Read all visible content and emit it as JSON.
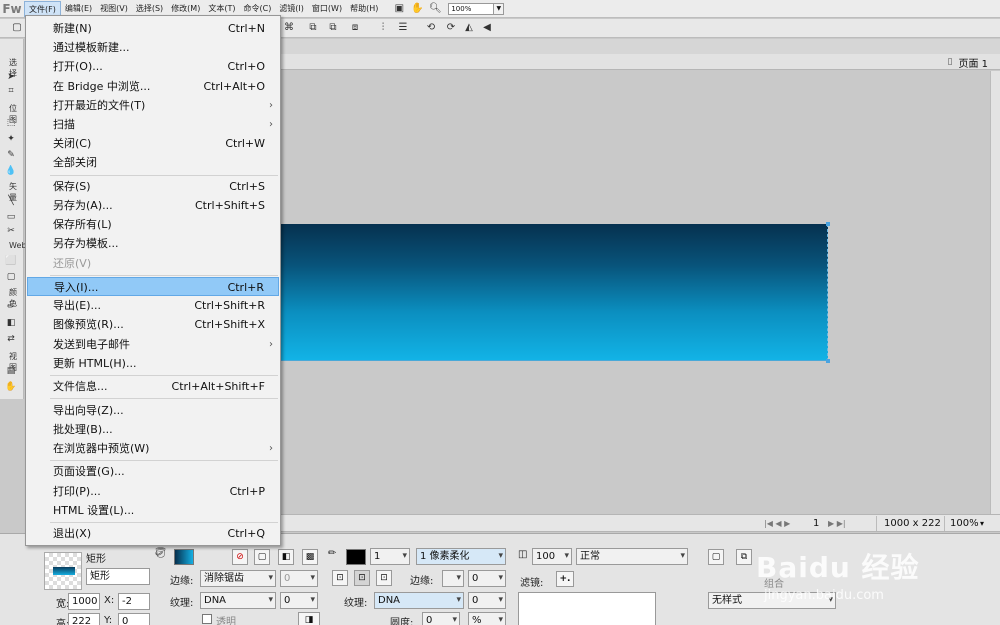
{
  "app": {
    "logo": "Fw",
    "menus": [
      "文件(F)",
      "编辑(E)",
      "视图(V)",
      "选择(S)",
      "修改(M)",
      "文本(T)",
      "命令(C)",
      "滤镜(I)",
      "窗口(W)",
      "帮助(H)"
    ],
    "zoom": "100%"
  },
  "file_menu": {
    "items": [
      {
        "label": "新建(N)",
        "shortcut": "Ctrl+N"
      },
      {
        "label": "通过模板新建...",
        "shortcut": ""
      },
      {
        "label": "打开(O)...",
        "shortcut": "Ctrl+O"
      },
      {
        "label": "在 Bridge 中浏览...",
        "shortcut": "Ctrl+Alt+O"
      },
      {
        "label": "打开最近的文件(T)",
        "shortcut": "",
        "submenu": true
      },
      {
        "label": "扫描",
        "shortcut": "",
        "submenu": true
      },
      {
        "label": "关闭(C)",
        "shortcut": "Ctrl+W"
      },
      {
        "label": "全部关闭",
        "shortcut": ""
      },
      {
        "label": "保存(S)",
        "shortcut": "Ctrl+S"
      },
      {
        "label": "另存为(A)...",
        "shortcut": "Ctrl+Shift+S"
      },
      {
        "label": "保存所有(L)",
        "shortcut": ""
      },
      {
        "label": "另存为模板...",
        "shortcut": ""
      },
      {
        "label": "还原(V)",
        "shortcut": "",
        "disabled": true
      },
      {
        "label": "导入(I)...",
        "shortcut": "Ctrl+R",
        "highlighted": true
      },
      {
        "label": "导出(E)...",
        "shortcut": "Ctrl+Shift+R"
      },
      {
        "label": "图像预览(R)...",
        "shortcut": "Ctrl+Shift+X"
      },
      {
        "label": "发送到电子邮件",
        "shortcut": "",
        "submenu": true
      },
      {
        "label": "更新 HTML(H)...",
        "shortcut": ""
      },
      {
        "label": "文件信息...",
        "shortcut": "Ctrl+Alt+Shift+F"
      },
      {
        "label": "导出向导(Z)...",
        "shortcut": ""
      },
      {
        "label": "批处理(B)...",
        "shortcut": ""
      },
      {
        "label": "在浏览器中预览(W)",
        "shortcut": "",
        "submenu": true
      },
      {
        "label": "页面设置(G)...",
        "shortcut": ""
      },
      {
        "label": "打印(P)...",
        "shortcut": "Ctrl+P"
      },
      {
        "label": "HTML 设置(L)...",
        "shortcut": ""
      },
      {
        "label": "退出(X)",
        "shortcut": "Ctrl+Q"
      }
    ]
  },
  "tools_panel": {
    "sections": [
      "选择",
      "位图",
      "矢量",
      "Web",
      "颜色",
      "视图"
    ]
  },
  "document": {
    "page_tab": "页面 1",
    "rect_gradient": [
      "#06314f",
      "#12b3e6"
    ]
  },
  "status": {
    "page_number": "1",
    "dimensions": "1000 x 222",
    "zoom": "100%"
  },
  "properties": {
    "object_type": "矩形",
    "object_name": "矩形",
    "width_label": "宽:",
    "width": "1000",
    "height_label": "高:",
    "height": "222",
    "x_label": "X:",
    "x": "-2",
    "y_label": "Y:",
    "y": "0",
    "edge_label": "边缘:",
    "edge_value": "消除锯齿",
    "edge_amount": "0",
    "texture_label": "纹理:",
    "texture_value": "DNA",
    "texture_amount": "0",
    "transparent_label": "透明",
    "stroke_size": "1",
    "stroke_type": "1 像素柔化",
    "stroke_edge_label": "边缘:",
    "stroke_edge_amount": "0",
    "stroke_texture_label": "纹理:",
    "stroke_texture_value": "DNA",
    "stroke_texture_amount": "0",
    "roundness_label": "圆度:",
    "roundness": "0",
    "roundness_unit": "%",
    "opacity": "100",
    "blend_mode": "正常",
    "filters_label": "滤镜:",
    "filters_add": "+.",
    "style_value": "无样式",
    "group_label": "组合"
  },
  "watermark": {
    "brand": "Baidu 经验",
    "url": "jingyan.baidu.com"
  }
}
